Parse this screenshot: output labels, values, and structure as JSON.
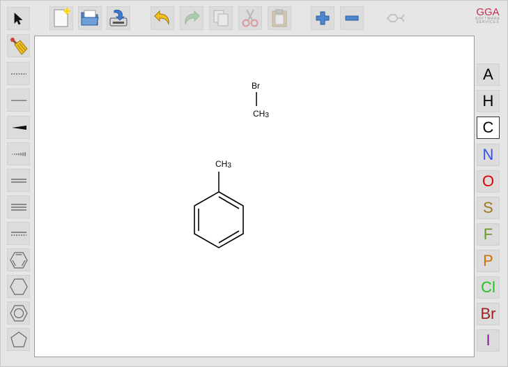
{
  "logo": {
    "main": "GGA",
    "sub1": "SOFTWARE",
    "sub2": "SERVICES"
  },
  "toolbar": {
    "items": [
      {
        "icon": "new-document-icon",
        "enabled": true
      },
      {
        "icon": "open-folder-icon",
        "enabled": true
      },
      {
        "icon": "save-icon",
        "enabled": true
      },
      {
        "icon": "undo-icon",
        "enabled": true
      },
      {
        "icon": "redo-icon",
        "enabled": false
      },
      {
        "icon": "copy-icon",
        "enabled": false
      },
      {
        "icon": "cut-icon",
        "enabled": false
      },
      {
        "icon": "paste-icon",
        "enabled": false
      },
      {
        "icon": "zoom-in-icon",
        "enabled": true
      },
      {
        "icon": "zoom-out-icon",
        "enabled": true
      },
      {
        "icon": "clean-structure-icon",
        "enabled": false
      }
    ]
  },
  "left_tools": [
    "select-arrow-icon",
    "eraser-icon",
    "any-bond-icon",
    "single-bond-icon",
    "wedge-bond-icon",
    "hash-bond-icon",
    "double-bond-icon",
    "triple-bond-icon",
    "aromatic-bond-icon",
    "benzene-ring-icon",
    "cyclohexane-icon",
    "cyclohexane-aromatic-icon",
    "cyclopentane-icon"
  ],
  "atoms": [
    {
      "label": "A",
      "color": "#000000"
    },
    {
      "label": "H",
      "color": "#000000"
    },
    {
      "label": "C",
      "color": "#000000",
      "selected": true
    },
    {
      "label": "N",
      "color": "#3050f8"
    },
    {
      "label": "O",
      "color": "#e00000"
    },
    {
      "label": "S",
      "color": "#a07820"
    },
    {
      "label": "F",
      "color": "#6a9a2a"
    },
    {
      "label": "P",
      "color": "#d07000"
    },
    {
      "label": "Cl",
      "color": "#20c020"
    },
    {
      "label": "Br",
      "color": "#a02020"
    },
    {
      "label": "I",
      "color": "#8a1a9a"
    }
  ],
  "molecule1": {
    "atom_top": "Br",
    "atom_bottom": "CH",
    "atom_bottom_sub": "3"
  },
  "molecule2": {
    "substituent": "CH",
    "substituent_sub": "3"
  }
}
